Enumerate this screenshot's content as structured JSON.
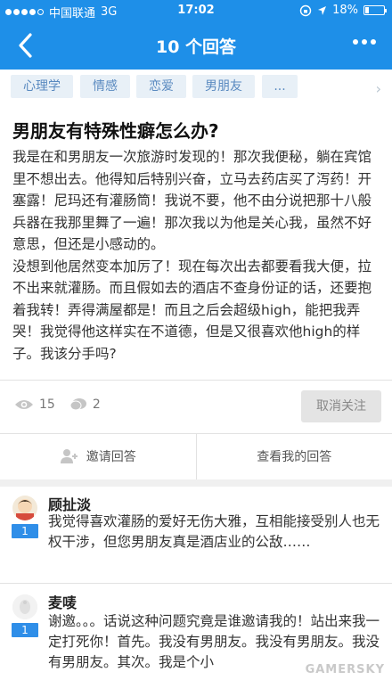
{
  "status_bar": {
    "carrier": "中国联通",
    "network": "3G",
    "time": "17:02",
    "battery": "18%"
  },
  "nav": {
    "title": "10 个回答"
  },
  "tags": [
    "心理学",
    "情感",
    "恋爱",
    "男朋友",
    "..."
  ],
  "question": {
    "title": "男朋友有特殊性癖怎么办?",
    "paragraphs": [
      "我是在和男朋友一次旅游时发现的！那次我便秘，躺在宾馆里不想出去。他得知后特别兴奋，立马去药店买了泻药！开塞露！尼玛还有灌肠筒！我说不要，他不由分说把那十八般兵器在我那里舞了一遍！那次我以为他是关心我，虽然不好意思，但还是小感动的。",
      "没想到他居然变本加厉了！现在每次出去都要看我大便，拉不出来就灌肠。而且假如去的酒店不查身份证的话，还要抱着我转！弄得满屋都是！而且之后会超级high，能把我弄哭！我觉得他这样实在不道德，但是又很喜欢他high的样子。我该分手吗?"
    ]
  },
  "stats": {
    "views": "15",
    "comments": "2",
    "unfollow_label": "取消关注"
  },
  "actions": {
    "invite_label": "邀请回答",
    "my_answer_label": "查看我的回答"
  },
  "answers": [
    {
      "name": "顾扯淡",
      "votes": "1",
      "text": "我觉得喜欢灌肠的爱好无伤大雅，互相能接受别人也无权干涉，但您男朋友真是酒店业的公敌……"
    },
    {
      "name": "麦唛",
      "votes": "1",
      "text": "谢邀。。。话说这种问题究竟是谁邀请我的！站出来我一定打死你！首先。我没有男朋友。我没有男朋友。我没有男朋友。其次。我是个小"
    }
  ],
  "watermark": "GAMERSKY",
  "colors": {
    "nav_blue": "#1e8fe8",
    "tag_bg": "#e8f0f7",
    "tag_text": "#5a8ac0",
    "vote_blue": "#2f8ee8"
  }
}
